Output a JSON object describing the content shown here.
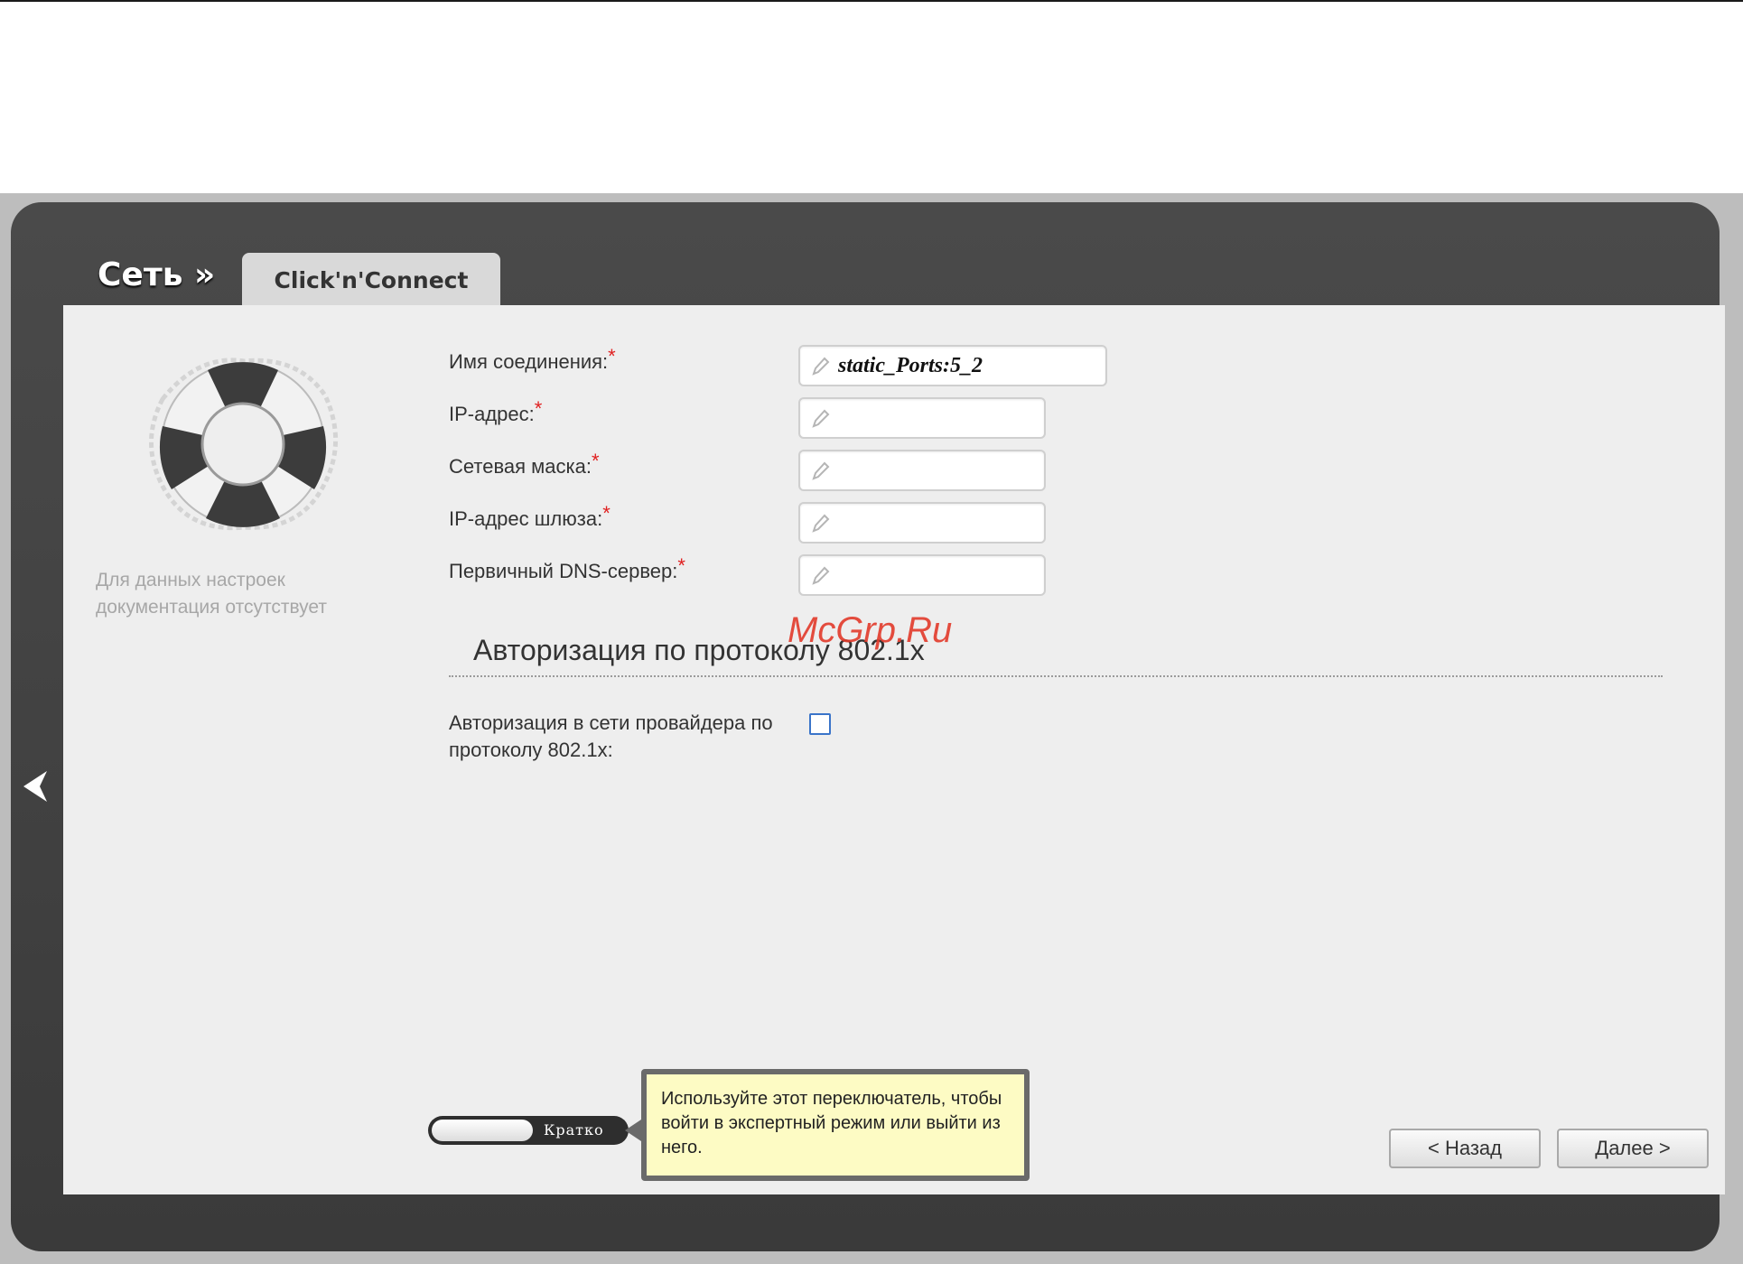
{
  "header": {
    "breadcrumb": "Сеть »",
    "tab_label": "Click'n'Connect"
  },
  "sidebar": {
    "doc_note": "Для данных настроек документация отсутствует",
    "help_icon": "lifebuoy-icon"
  },
  "form": {
    "required_mark": "*",
    "fields": [
      {
        "label": "Имя соединения:",
        "value": "static_Ports:5_2",
        "placeholder": ""
      },
      {
        "label": "IP-адрес:",
        "value": "",
        "placeholder": ""
      },
      {
        "label": "Сетевая маска:",
        "value": "",
        "placeholder": ""
      },
      {
        "label": "IP-адрес шлюза:",
        "value": "",
        "placeholder": ""
      },
      {
        "label": "Первичный DNS-сервер:",
        "value": "",
        "placeholder": ""
      }
    ]
  },
  "watermark": "McGrp.Ru",
  "auth_section": {
    "title": "Авторизация по протоколу 802.1x",
    "checkbox_label": "Авторизация в сети провайдера по протоколу 802.1x:",
    "checked": false
  },
  "mode_toggle": {
    "label": "Кратко",
    "tooltip": "Используйте этот переключатель, чтобы войти в экспертный режим или выйти из него."
  },
  "buttons": {
    "back": "< Назад",
    "next": "Далее >"
  },
  "colors": {
    "frame": "#3f3f3f",
    "panel": "#eeeeee",
    "required": "#e02020",
    "tooltip_bg": "#fdfbc4",
    "checkbox_border": "#3a74c9"
  }
}
